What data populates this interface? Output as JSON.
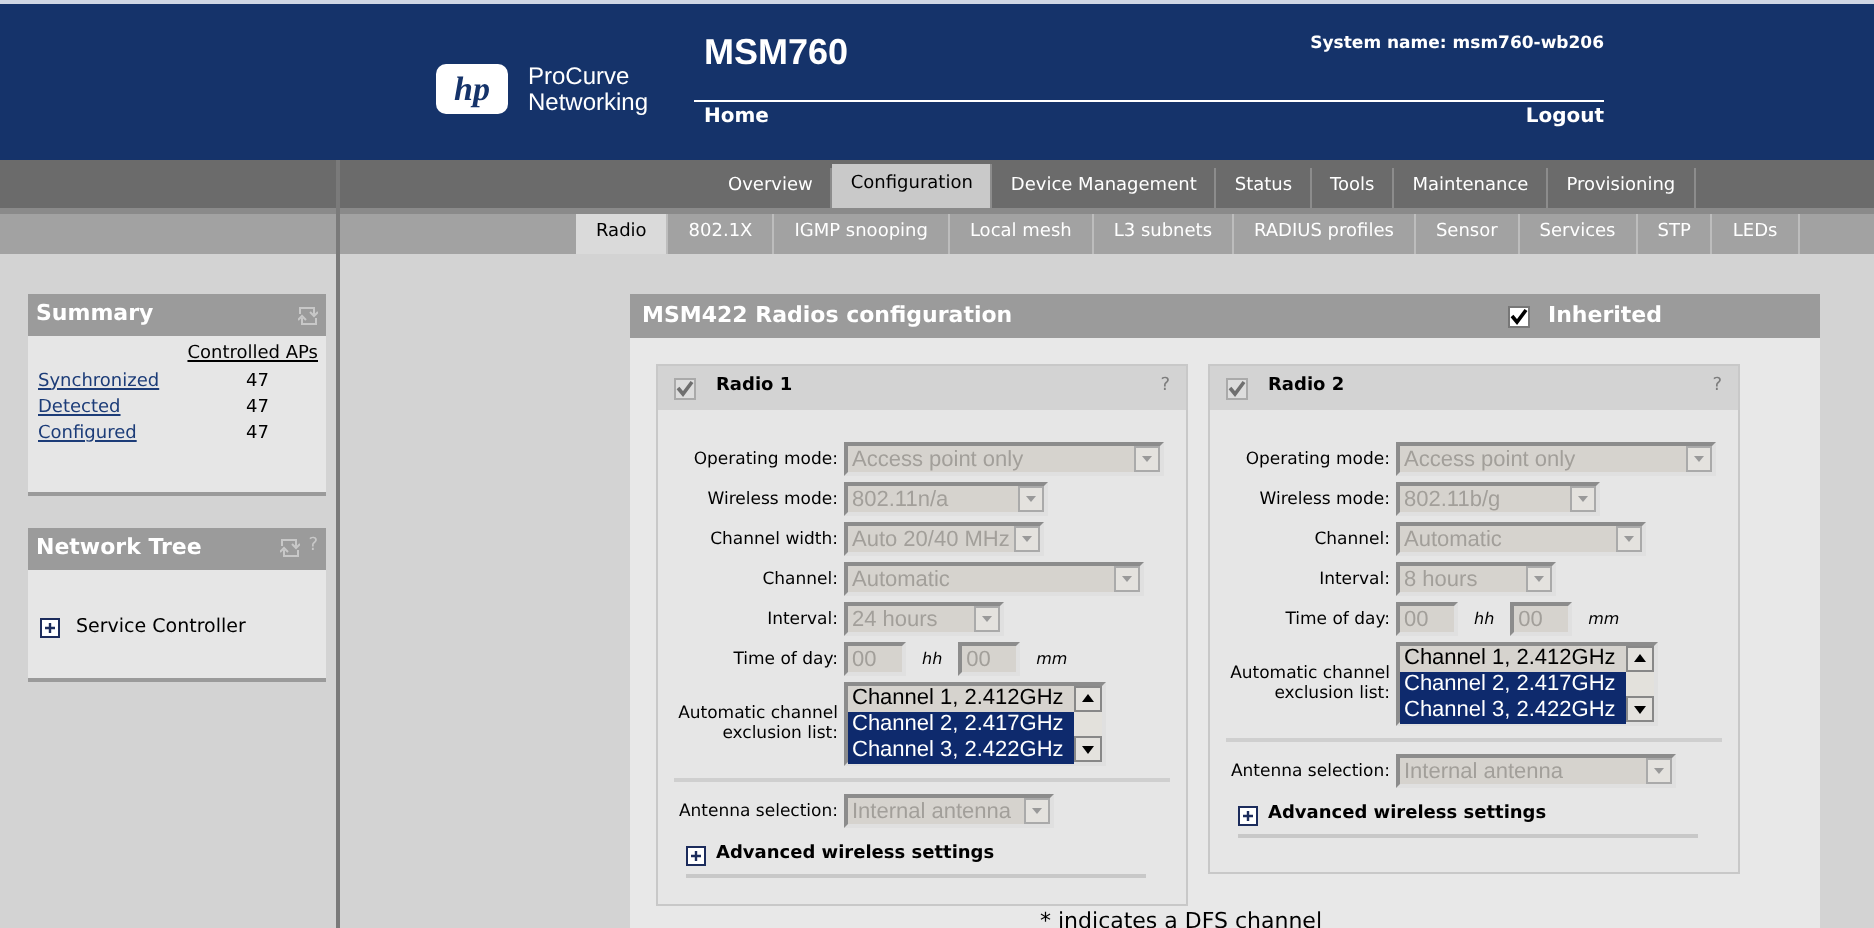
{
  "header": {
    "logo_mark": "hp",
    "brand": [
      "ProCurve",
      "Networking"
    ],
    "title": "MSM760",
    "system_name": "System name: msm760-wb206",
    "links": [
      "Home",
      "Logout"
    ]
  },
  "main_tabs": [
    {
      "label": "Overview",
      "selected": false
    },
    {
      "label": "Configuration",
      "selected": true
    },
    {
      "label": "Device Management",
      "selected": false
    },
    {
      "label": "Status",
      "selected": false
    },
    {
      "label": "Tools",
      "selected": false
    },
    {
      "label": "Maintenance",
      "selected": false
    },
    {
      "label": "Provisioning",
      "selected": false
    }
  ],
  "sub_tabs": [
    {
      "label": "Radio",
      "selected": true
    },
    {
      "label": "802.1X",
      "selected": false
    },
    {
      "label": "IGMP snooping",
      "selected": false
    },
    {
      "label": "Local mesh",
      "selected": false
    },
    {
      "label": "L3 subnets",
      "selected": false
    },
    {
      "label": "RADIUS profiles",
      "selected": false
    },
    {
      "label": "Sensor",
      "selected": false
    },
    {
      "label": "Services",
      "selected": false
    },
    {
      "label": "STP",
      "selected": false
    },
    {
      "label": "LEDs",
      "selected": false
    }
  ],
  "sidebar": {
    "summary": {
      "title": "Summary",
      "column": "Controlled APs",
      "rows": [
        {
          "label": "Synchronized",
          "value": "47"
        },
        {
          "label": "Detected",
          "value": "47"
        },
        {
          "label": "Configured",
          "value": "47"
        }
      ]
    },
    "network_tree": {
      "title": "Network Tree",
      "help": "?",
      "items": [
        {
          "label": "Service Controller",
          "expanded": false
        }
      ]
    }
  },
  "panel": {
    "title": "MSM422 Radios configuration",
    "inherited": {
      "label": "Inherited",
      "checked": true
    },
    "radios": [
      {
        "title": "Radio 1",
        "checked": true,
        "disabled": true,
        "help": "?",
        "fields": [
          {
            "kind": "select",
            "label": "Operating mode:",
            "value": "Access point only",
            "disabled": true
          },
          {
            "kind": "select",
            "label": "Wireless mode:",
            "value": "802.11n/a",
            "disabled": true
          },
          {
            "kind": "select",
            "label": "Channel width:",
            "value": "Auto 20/40 MHz",
            "disabled": true
          },
          {
            "kind": "select",
            "label": "Channel:",
            "value": "Automatic",
            "disabled": true
          },
          {
            "kind": "select",
            "label": "Interval:",
            "value": "24 hours",
            "disabled": true
          },
          {
            "kind": "time",
            "label": "Time of day:",
            "hours": "00",
            "hours_unit": "hh",
            "minutes": "00",
            "minutes_unit": "mm",
            "disabled": true
          },
          {
            "kind": "listbox",
            "label": "Automatic channel exclusion list:",
            "options": [
              {
                "label": "Channel 1, 2.412GHz",
                "selected": false
              },
              {
                "label": "Channel 2, 2.417GHz",
                "selected": true
              },
              {
                "label": "Channel 3, 2.422GHz",
                "selected": true
              }
            ]
          },
          {
            "kind": "select",
            "label": "Antenna selection:",
            "value": "Internal antenna",
            "disabled": true
          }
        ],
        "advanced": {
          "label": "Advanced wireless settings",
          "expanded": false
        }
      },
      {
        "title": "Radio 2",
        "checked": true,
        "disabled": true,
        "help": "?",
        "fields": [
          {
            "kind": "select",
            "label": "Operating mode:",
            "value": "Access point only",
            "disabled": true
          },
          {
            "kind": "select",
            "label": "Wireless mode:",
            "value": "802.11b/g",
            "disabled": true
          },
          {
            "kind": "select",
            "label": "Channel:",
            "value": "Automatic",
            "disabled": true
          },
          {
            "kind": "select",
            "label": "Interval:",
            "value": "8 hours",
            "disabled": true
          },
          {
            "kind": "time",
            "label": "Time of day:",
            "hours": "00",
            "hours_unit": "hh",
            "minutes": "00",
            "minutes_unit": "mm",
            "disabled": true
          },
          {
            "kind": "listbox",
            "label": "Automatic channel exclusion list:",
            "options": [
              {
                "label": "Channel 1, 2.412GHz",
                "selected": false
              },
              {
                "label": "Channel 2, 2.417GHz",
                "selected": true
              },
              {
                "label": "Channel 3, 2.422GHz",
                "selected": true
              }
            ]
          },
          {
            "kind": "select",
            "label": "Antenna selection:",
            "value": "Internal antenna",
            "disabled": true
          }
        ],
        "advanced": {
          "label": "Advanced wireless settings",
          "expanded": false
        }
      }
    ],
    "footnote": "* indicates a DFS channel"
  }
}
